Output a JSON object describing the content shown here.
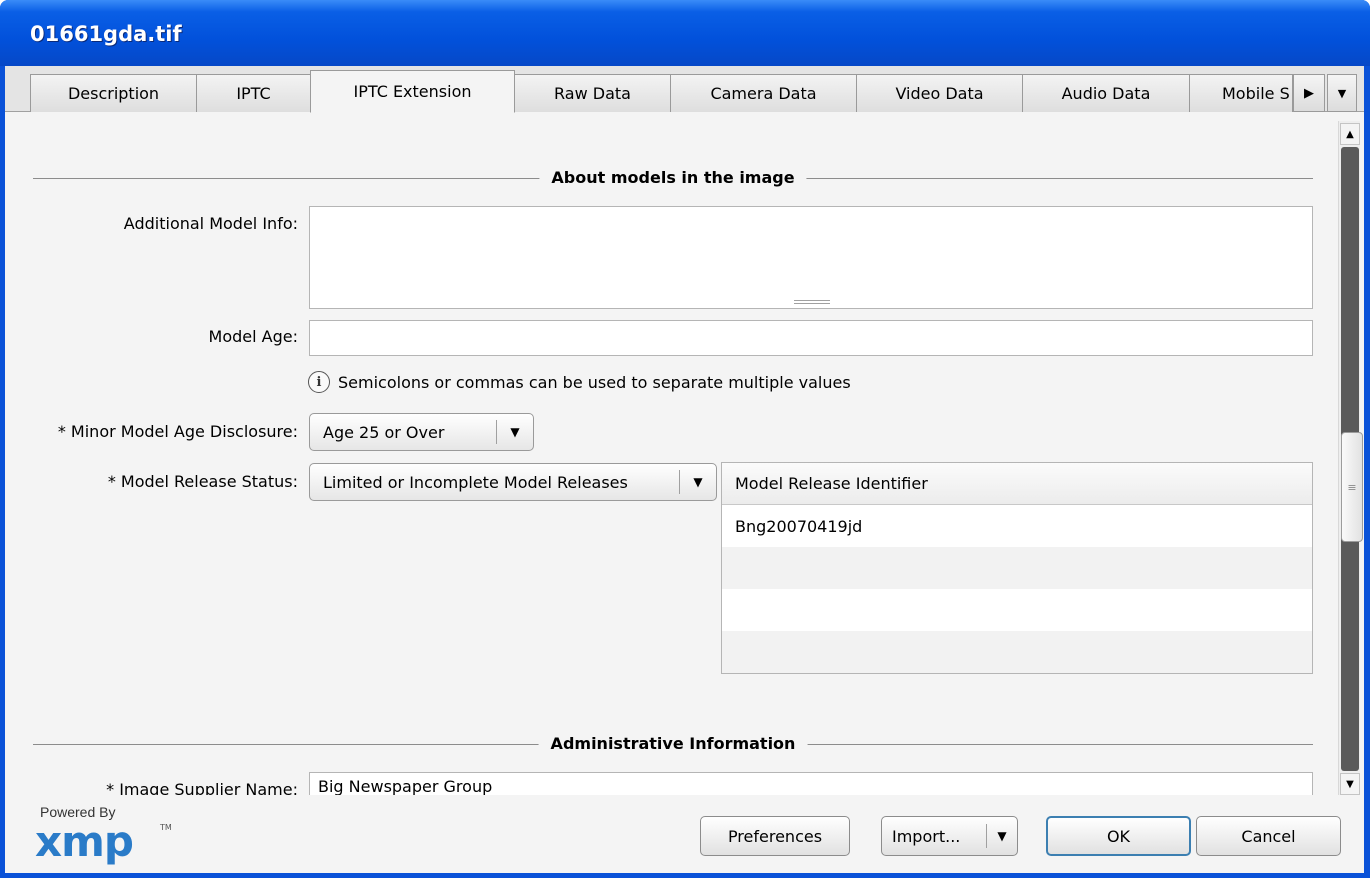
{
  "window": {
    "title": "01661gda.tif"
  },
  "tabs": [
    {
      "label": "Description"
    },
    {
      "label": "IPTC"
    },
    {
      "label": "IPTC Extension",
      "active": true
    },
    {
      "label": "Raw Data"
    },
    {
      "label": "Camera Data"
    },
    {
      "label": "Video Data"
    },
    {
      "label": "Audio Data"
    },
    {
      "label": "Mobile S"
    }
  ],
  "tab_scroll_icons": {
    "next": "▶",
    "menu": "▼"
  },
  "sections": {
    "models": {
      "heading": "About models in the image",
      "additional_model_info": {
        "label": "Additional Model Info:",
        "value": ""
      },
      "model_age": {
        "label": "Model Age:",
        "value": ""
      },
      "hint": "Semicolons or commas can be used to separate multiple values",
      "minor_age_disclosure": {
        "label": "* Minor Model Age Disclosure:",
        "value": "Age 25 or Over"
      },
      "release_status": {
        "label": "* Model Release Status:",
        "value": "Limited or Incomplete Model Releases"
      },
      "release_table": {
        "header": "Model Release Identifier",
        "rows": [
          "Bng20070419jd",
          "",
          "",
          ""
        ]
      }
    },
    "admin": {
      "heading": "Administrative Information",
      "supplier": {
        "label": "* Image Supplier Name:",
        "value": "Big Newspaper Group"
      }
    }
  },
  "footer": {
    "powered_by": "Powered By",
    "logo": "xmp",
    "logo_tm": "TM",
    "buttons": {
      "preferences": "Preferences",
      "import": "Import...",
      "ok": "OK",
      "cancel": "Cancel"
    }
  },
  "icons": {
    "info": "i",
    "dropdown_arrow": "▼",
    "scroll_up": "▲",
    "scroll_down": "▼",
    "thumb_grip": "≡"
  }
}
